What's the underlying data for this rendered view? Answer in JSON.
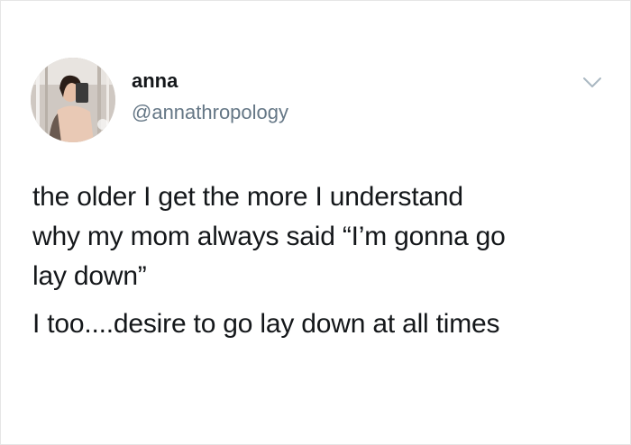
{
  "tweet": {
    "author": {
      "name": "anna",
      "handle": "@annathropology",
      "avatar_icon": "profile-photo"
    },
    "menu_icon": "chevron-down-icon",
    "paragraphs": [
      "the older I get the more I understand\nwhy my mom always said “I’m gonna go\nlay down”",
      "I too....desire to go lay down at all times"
    ]
  },
  "colors": {
    "text": "#14171a",
    "secondary_text": "#657786",
    "chevron": "#aab8c2",
    "background": "#ffffff"
  }
}
